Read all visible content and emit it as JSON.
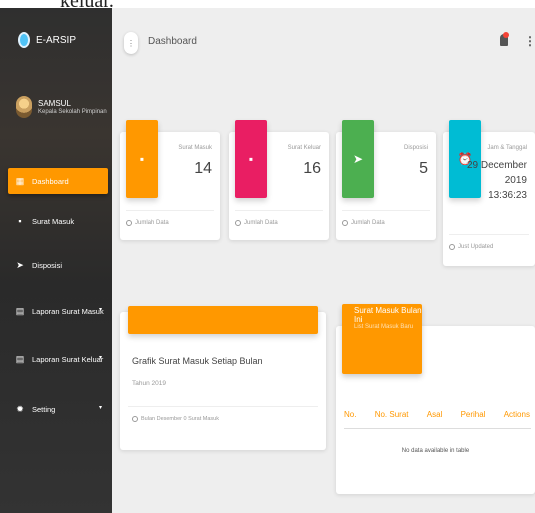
{
  "top_text": "keluar.",
  "sidebar": {
    "brand": "E-ARSIP",
    "user": {
      "name": "SAMSUL",
      "role": "Kepala Sekolah Pimpinan"
    },
    "items": [
      {
        "label": "Dashboard",
        "icon": "dashboard-icon",
        "active": true
      },
      {
        "label": "Surat Masuk",
        "icon": "mail-in-icon"
      },
      {
        "label": "Disposisi",
        "icon": "send-icon"
      },
      {
        "label": "Laporan Surat Masuk",
        "icon": "report-icon",
        "caret": "▾"
      },
      {
        "label": "Laporan Surat Keluar",
        "icon": "report-icon",
        "caret": "▾"
      },
      {
        "label": "Setting",
        "icon": "gear-icon",
        "caret": "▾"
      }
    ]
  },
  "header": {
    "menu_icon": "⋮",
    "title": "Dashboard",
    "more_icon": "⋮"
  },
  "cards": [
    {
      "category": "Surat Masuk",
      "value": "14",
      "footer": "Jumlah Data",
      "color": "#ff9800",
      "icon": "▪"
    },
    {
      "category": "Surat Keluar",
      "value": "16",
      "footer": "Jumlah Data",
      "color": "#e91e63",
      "icon": "▪"
    },
    {
      "category": "Disposisi",
      "value": "5",
      "footer": "Jumlah Data",
      "color": "#4caf50",
      "icon": "➤"
    },
    {
      "category": "Jam & Tanggal",
      "date_line1": "29 December",
      "date_line2": "2019",
      "time": "13:36:23",
      "footer": "Just Updated",
      "color": "#00bcd4",
      "icon": "⏰"
    }
  ],
  "grafik": {
    "title": "Grafik Surat Masuk Setiap Bulan",
    "subtitle": "Tahun 2019",
    "footer": "Bulan Desember 0 Surat Masuk"
  },
  "table": {
    "title": "Surat Masuk Bulan Ini",
    "subtitle": "List Surat Masuk Baru",
    "columns": [
      "No.",
      "No. Surat",
      "Asal",
      "Perihal",
      "Actions"
    ],
    "empty": "No data available in table"
  },
  "colors": {
    "accent": "#ff9800",
    "pink": "#e91e63",
    "green": "#4caf50",
    "cyan": "#00bcd4"
  }
}
